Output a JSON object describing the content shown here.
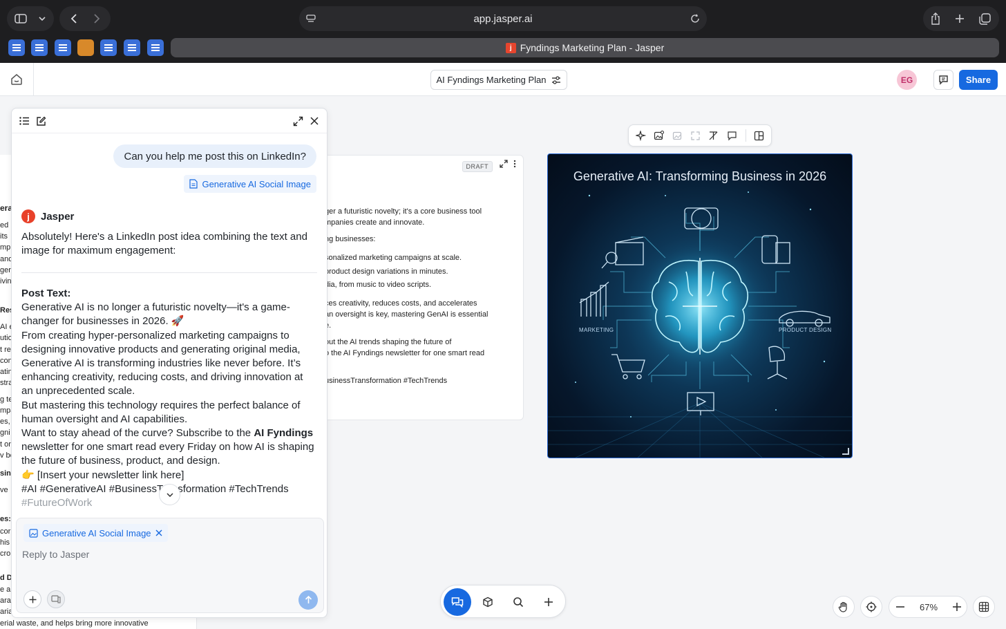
{
  "browser": {
    "url": "app.jasper.ai",
    "active_tab_title": "Fyndings Marketing Plan - Jasper",
    "tab_favicon_letter": "j"
  },
  "header": {
    "doc_title": "AI Fyndings Marketing Plan",
    "avatar_initials": "EG",
    "share_label": "Share"
  },
  "left_doc_fragments": [
    "era",
    "ed",
    "its",
    "mple",
    "and",
    "ger",
    "ivin",
    "Resu",
    "AI e",
    "utio",
    "t re",
    "con",
    "atin",
    "stra",
    "g te",
    "mpa",
    "es,",
    "gni",
    "t on",
    "v be",
    "sin",
    "ve",
    "es: I",
    "cor",
    "his",
    "cro",
    "d De",
    "e ar",
    "ara",
    "aria",
    "erial waste, and helps bring more innovative"
  ],
  "mid_doc": {
    "draft_label": "DRAFT",
    "fragments": [
      "ger a futuristic novelty; it's a core business tool",
      "mpanies create and innovate.",
      "ng businesses:",
      "sonalized marketing campaigns at scale.",
      "product design variations in minutes.",
      "dia, from music to video scripts.",
      "ces creativity, reduces costs, and accelerates",
      "an oversight is key, mastering GenAI is essential",
      "e.",
      "out the AI trends shaping the future of",
      "o the AI Fyndings newsletter for one smart read",
      "usinessTransformation #TechTrends"
    ]
  },
  "generated_image": {
    "title": "Generative AI: Transforming Business in 2026",
    "label_marketing": "MARKETING",
    "label_product_design": "PRODUCT DESIGN"
  },
  "chat": {
    "user_message": "Can you help me post this on LinkedIn?",
    "attachment_name": "Generative AI Social Image",
    "assistant_name": "Jasper",
    "assistant_intro": "Absolutely! Here's a LinkedIn post idea combining the text and image for maximum engagement:",
    "post_heading": "Post Text:",
    "post_p1": "Generative AI is no longer a futuristic novelty—it's a game-changer for businesses in 2026. 🚀",
    "post_p2": "From creating hyper-personalized marketing campaigns to designing innovative products and generating original media, Generative AI is transforming industries like never before. It’s enhancing creativity, reducing costs, and driving innovation at an unprecedented scale.",
    "post_p3": "But mastering this technology requires the perfect balance of human oversight and AI capabilities.",
    "post_p4_before": "Want to stay ahead of the curve? Subscribe to the ",
    "post_p4_bold": "AI Fyndings",
    "post_p4_after": " newsletter for one smart read every Friday on how AI is shaping the future of business, product, and design.",
    "post_p5": "👉 [Insert your newsletter link here]",
    "post_hashtags": "#AI #GenerativeAI #BusinessTransformation #TechTrends",
    "post_hashtags_2": "#FutureOfWork",
    "composer_attachment": "Generative AI Social Image",
    "reply_placeholder": "Reply to Jasper"
  },
  "zoom": {
    "level": "67%"
  },
  "colors": {
    "accent": "#1769e0",
    "jasper_red": "#e8412a"
  }
}
